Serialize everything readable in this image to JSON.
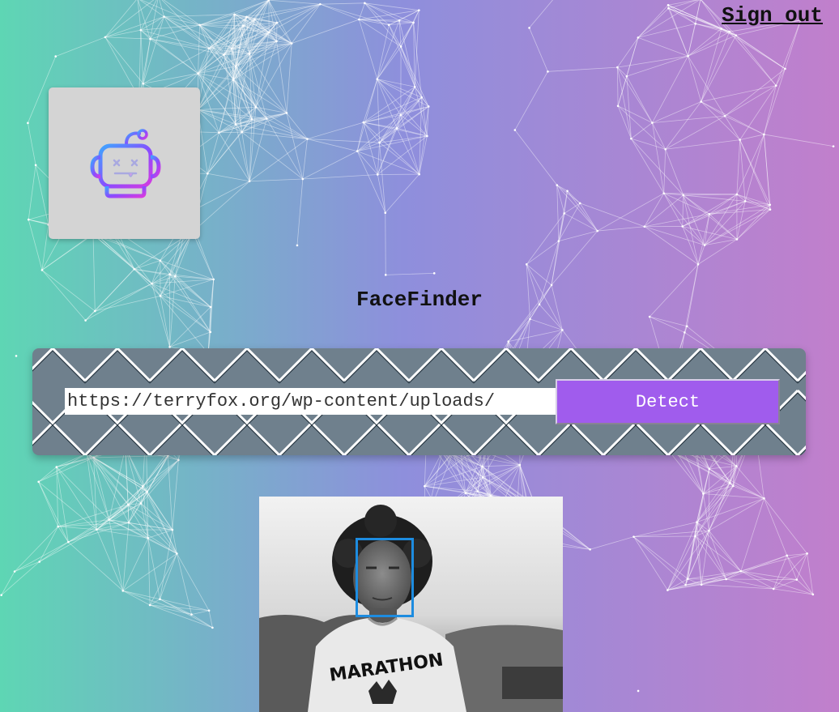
{
  "header": {
    "signout_label": "Sign out"
  },
  "logo": {
    "icon": "robot-icon",
    "accent_colors": [
      "#8a4cff",
      "#3ea6ff",
      "#d63be0"
    ]
  },
  "app": {
    "title": "FaceFinder"
  },
  "form": {
    "url_value": "https://terryfox.org/wp-content/uploads/",
    "detect_label": "Detect"
  },
  "result": {
    "image_description_text": "MARATHON",
    "face_box_count": 1,
    "face_box_color": "#1d8ce0"
  },
  "colors": {
    "gradient_left": "#5ed6b4",
    "gradient_mid": "#8e8fdc",
    "gradient_right": "#c17fcc",
    "panel": "#6f808d",
    "button": "#a05ced"
  }
}
